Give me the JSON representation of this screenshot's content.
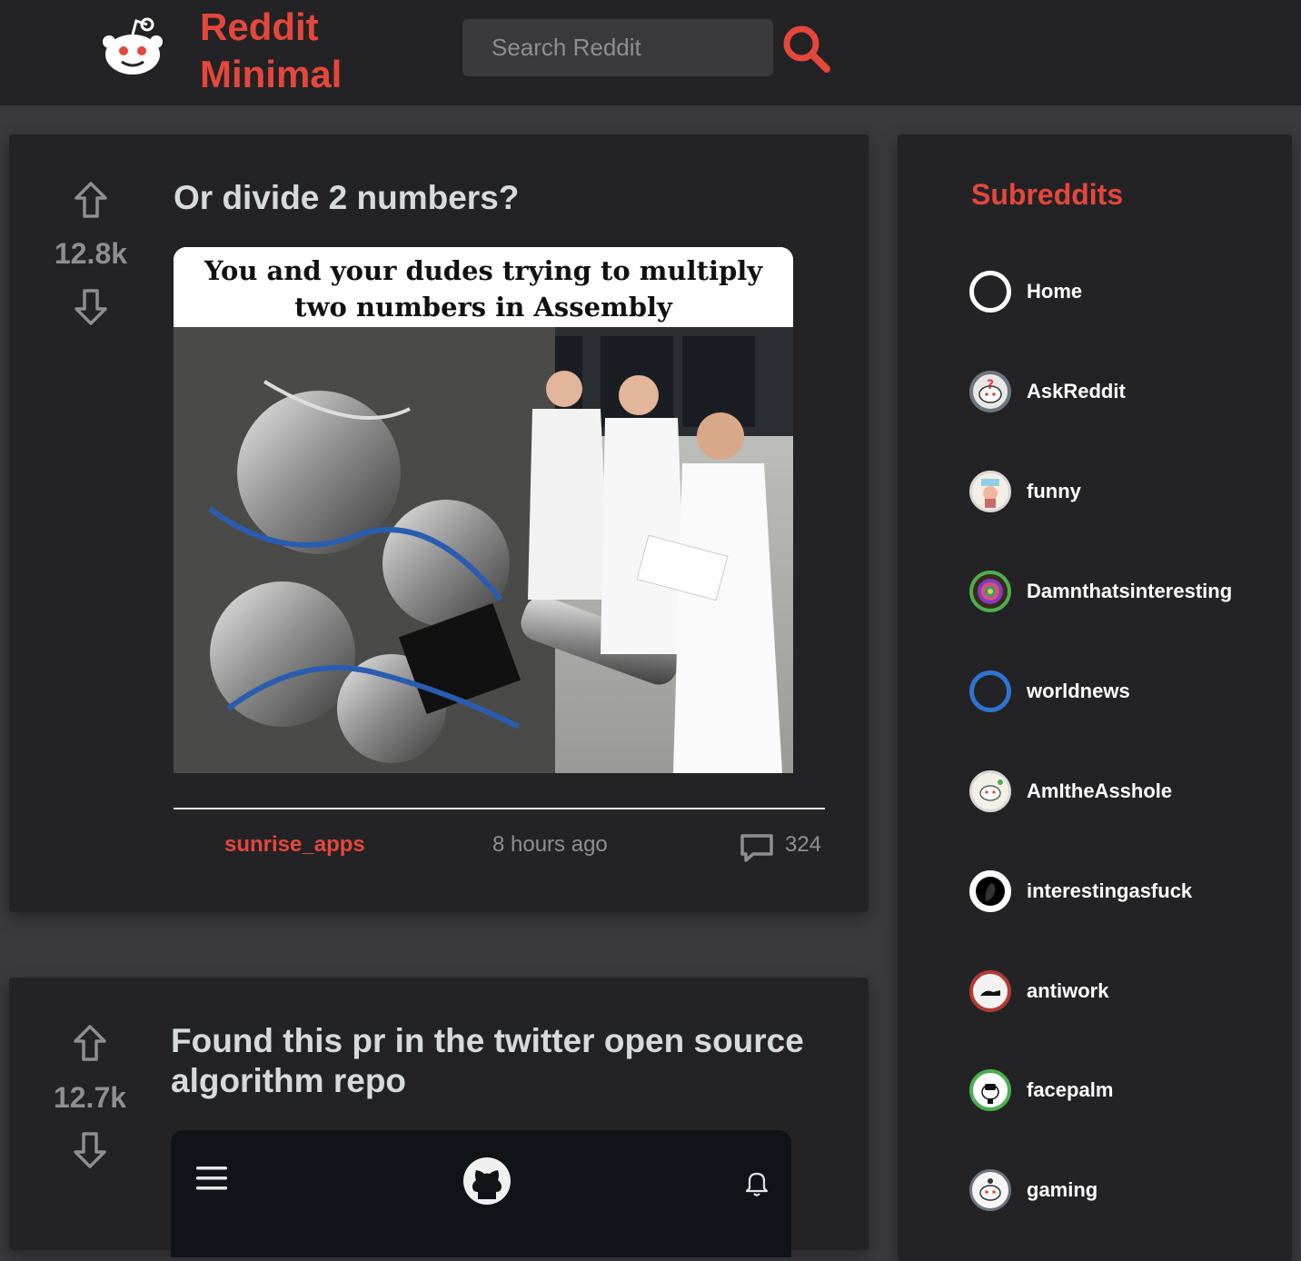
{
  "header": {
    "brand_line1": "Reddit",
    "brand_line2": "Minimal",
    "search_placeholder": "Search Reddit",
    "accent_color": "#e5473d"
  },
  "posts": [
    {
      "title": "Or divide 2 numbers?",
      "score": "12.8k",
      "meme_caption_line1": "You and your dudes trying to multiply",
      "meme_caption_line2": "two numbers in Assembly",
      "author": "sunrise_apps",
      "time": "8 hours ago",
      "comments": "324"
    },
    {
      "title_line1": "Found this pr in the twitter open source",
      "title_line2": "algorithm repo",
      "score": "12.7k"
    }
  ],
  "sidebar": {
    "title": "Subreddits",
    "items": [
      {
        "label": "Home",
        "icon": "home-ring-icon"
      },
      {
        "label": "AskReddit",
        "icon": "askreddit-icon"
      },
      {
        "label": "funny",
        "icon": "funny-icon"
      },
      {
        "label": "Damnthatsinteresting",
        "icon": "damnthatsinteresting-icon"
      },
      {
        "label": "worldnews",
        "icon": "worldnews-ring-icon"
      },
      {
        "label": "AmItheAsshole",
        "icon": "amitheasshole-icon"
      },
      {
        "label": "interestingasfuck",
        "icon": "interestingasfuck-icon"
      },
      {
        "label": "antiwork",
        "icon": "antiwork-icon"
      },
      {
        "label": "facepalm",
        "icon": "facepalm-icon"
      },
      {
        "label": "gaming",
        "icon": "gaming-icon"
      }
    ]
  }
}
